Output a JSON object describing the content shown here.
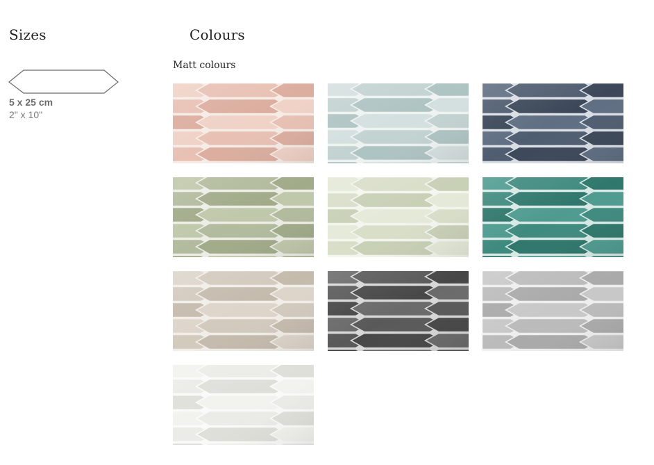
{
  "sizes": {
    "heading": "Sizes",
    "options": [
      {
        "metric": "5 x 25 cm",
        "imperial": "2\" x 10\"",
        "shape_icon": "picket-tile-outline-icon"
      }
    ]
  },
  "colours": {
    "heading": "Colours",
    "subheading": "Matt colours",
    "swatches": [
      {
        "name": "pink",
        "base": "#e8c1b4",
        "shade": "#dcae9f",
        "light": "#f0d2c7",
        "grout": "#f6ece6"
      },
      {
        "name": "pale-aqua",
        "base": "#c3d3d2",
        "shade": "#aec4c3",
        "light": "#d4e0df",
        "grout": "#eef3f2"
      },
      {
        "name": "navy",
        "base": "#4f5d70",
        "shade": "#3c4859",
        "light": "#5f6e82",
        "grout": "#d9dee4"
      },
      {
        "name": "sage",
        "base": "#b2bb9d",
        "shade": "#a1ab89",
        "light": "#c0c8ab",
        "grout": "#eceee6"
      },
      {
        "name": "mint-cream",
        "base": "#d9dec9",
        "shade": "#c8d0b6",
        "light": "#e5e9d8",
        "grout": "#f3f5ee"
      },
      {
        "name": "teal",
        "base": "#3f8a7f",
        "shade": "#2f776c",
        "light": "#4f9b90",
        "grout": "#d8e9e5"
      },
      {
        "name": "sand",
        "base": "#d3cabe",
        "shade": "#c5bbad",
        "light": "#ddd5ca",
        "grout": "#f1ede8"
      },
      {
        "name": "charcoal",
        "base": "#595959",
        "shade": "#474747",
        "light": "#6a6a6a",
        "grout": "#d7d7d7"
      },
      {
        "name": "grey",
        "base": "#bbbbbb",
        "shade": "#aaaaaa",
        "light": "#c8c8c8",
        "grout": "#eeeeee"
      },
      {
        "name": "white",
        "base": "#ebebe7",
        "shade": "#dfdfda",
        "light": "#f2f2ee",
        "grout": "#fafaf8"
      }
    ]
  }
}
